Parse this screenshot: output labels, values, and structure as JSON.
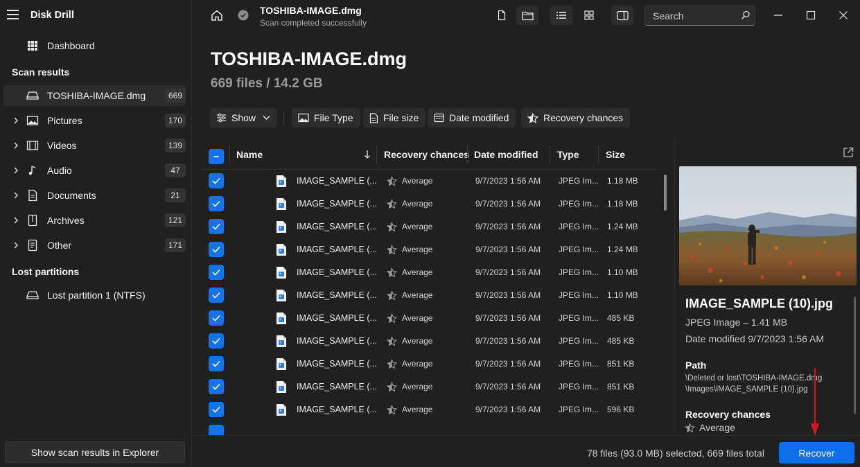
{
  "app": {
    "title": "Disk Drill"
  },
  "sidebar": {
    "dashboard_label": "Dashboard",
    "scan_results_heading": "Scan results",
    "scan_results": [
      {
        "label": "TOSHIBA-IMAGE.dmg",
        "count": "669",
        "icon": "drive-icon",
        "active": true
      },
      {
        "label": "Pictures",
        "count": "170",
        "icon": "picture-icon"
      },
      {
        "label": "Videos",
        "count": "139",
        "icon": "video-icon"
      },
      {
        "label": "Audio",
        "count": "47",
        "icon": "music-note-icon"
      },
      {
        "label": "Documents",
        "count": "21",
        "icon": "document-icon"
      },
      {
        "label": "Archives",
        "count": "121",
        "icon": "archive-icon"
      },
      {
        "label": "Other",
        "count": "171",
        "icon": "other-file-icon"
      }
    ],
    "lost_partitions_heading": "Lost partitions",
    "lost_partitions": [
      {
        "label": "Lost partition 1 (NTFS)",
        "icon": "drive-icon"
      }
    ],
    "explorer_button": "Show scan results in Explorer"
  },
  "topbar": {
    "title": "TOSHIBA-IMAGE.dmg",
    "subtitle": "Scan completed successfully",
    "search_placeholder": "Search"
  },
  "header": {
    "title": "TOSHIBA-IMAGE.dmg",
    "summary": "669 files / 14.2 GB"
  },
  "filters": {
    "show": "Show",
    "file_type": "File Type",
    "file_size": "File size",
    "date_modified": "Date modified",
    "recovery_chances": "Recovery chances"
  },
  "table": {
    "columns": {
      "name": "Name",
      "recovery": "Recovery chances",
      "date": "Date modified",
      "type": "Type",
      "size": "Size"
    },
    "rows": [
      {
        "name": "IMAGE_SAMPLE (...",
        "recovery": "Average",
        "date": "9/7/2023 1:56 AM",
        "type": "JPEG Im...",
        "size": "1.18 MB"
      },
      {
        "name": "IMAGE_SAMPLE (...",
        "recovery": "Average",
        "date": "9/7/2023 1:56 AM",
        "type": "JPEG Im...",
        "size": "1.18 MB"
      },
      {
        "name": "IMAGE_SAMPLE (...",
        "recovery": "Average",
        "date": "9/7/2023 1:56 AM",
        "type": "JPEG Im...",
        "size": "1.24 MB"
      },
      {
        "name": "IMAGE_SAMPLE (...",
        "recovery": "Average",
        "date": "9/7/2023 1:56 AM",
        "type": "JPEG Im...",
        "size": "1.24 MB"
      },
      {
        "name": "IMAGE_SAMPLE (...",
        "recovery": "Average",
        "date": "9/7/2023 1:56 AM",
        "type": "JPEG Im...",
        "size": "1.10 MB"
      },
      {
        "name": "IMAGE_SAMPLE (...",
        "recovery": "Average",
        "date": "9/7/2023 1:56 AM",
        "type": "JPEG Im...",
        "size": "1.10 MB"
      },
      {
        "name": "IMAGE_SAMPLE (...",
        "recovery": "Average",
        "date": "9/7/2023 1:56 AM",
        "type": "JPEG Im...",
        "size": "485 KB"
      },
      {
        "name": "IMAGE_SAMPLE (...",
        "recovery": "Average",
        "date": "9/7/2023 1:56 AM",
        "type": "JPEG Im...",
        "size": "485 KB"
      },
      {
        "name": "IMAGE_SAMPLE (...",
        "recovery": "Average",
        "date": "9/7/2023 1:56 AM",
        "type": "JPEG Im...",
        "size": "851 KB"
      },
      {
        "name": "IMAGE_SAMPLE (...",
        "recovery": "Average",
        "date": "9/7/2023 1:56 AM",
        "type": "JPEG Im...",
        "size": "851 KB"
      },
      {
        "name": "IMAGE_SAMPLE (...",
        "recovery": "Average",
        "date": "9/7/2023 1:56 AM",
        "type": "JPEG Im...",
        "size": "596 KB"
      }
    ]
  },
  "preview": {
    "file_name": "IMAGE_SAMPLE (10).jpg",
    "type_size": "JPEG Image – 1.41 MB",
    "date_modified": "Date modified 9/7/2023 1:56 AM",
    "path_heading": "Path",
    "path": "\\Deleted or lost\\TOSHIBA-IMAGE.dmg \\Images\\IMAGE_SAMPLE (10).jpg",
    "recovery_heading": "Recovery chances",
    "recovery_value": "Average"
  },
  "footer": {
    "status": "78 files (93.0 MB) selected, 669 files total",
    "recover_button": "Recover"
  },
  "colors": {
    "accent": "#1473e6",
    "background": "#202020",
    "annotation_arrow": "#d0161c"
  }
}
